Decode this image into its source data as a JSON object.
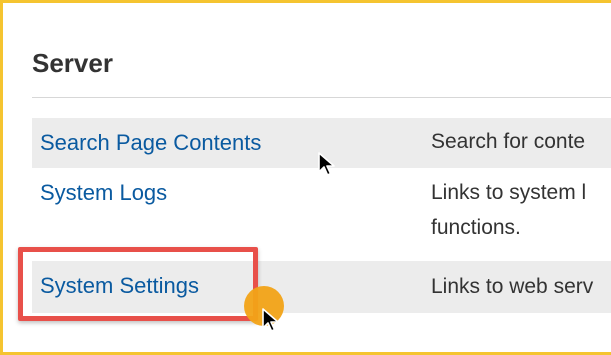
{
  "section": {
    "title": "Server"
  },
  "rows": [
    {
      "link": "Search Page Contents",
      "description": "Search for conte"
    },
    {
      "link": "System Logs",
      "description_line1": "Links to system l",
      "description_line2": "functions."
    },
    {
      "link": "System Settings",
      "description": "Links to web serv"
    }
  ],
  "colors": {
    "frame": "#f5c430",
    "link": "#0a5aa0",
    "highlight": "#e8504a",
    "click_indicator": "#f2a317",
    "row_shade": "#ececec"
  },
  "icons": {
    "cursor": "mouse-pointer-icon"
  }
}
